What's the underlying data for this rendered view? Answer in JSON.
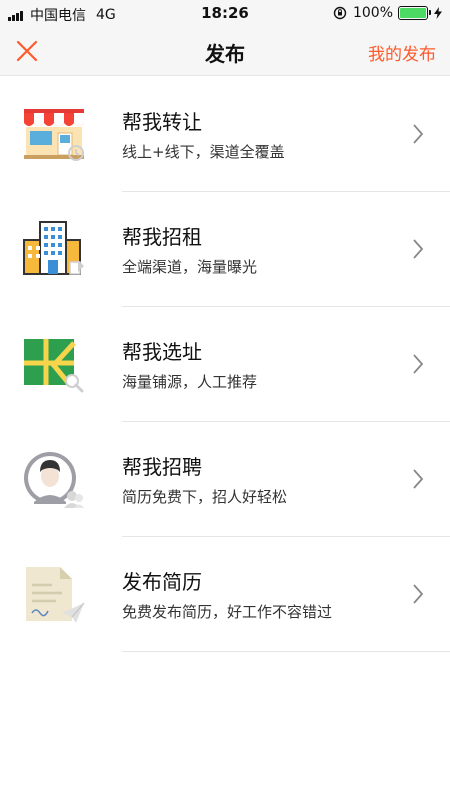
{
  "status_bar": {
    "carrier": "中国电信",
    "network": "4G",
    "time": "18:26",
    "battery": "100%"
  },
  "nav": {
    "title": "发布",
    "right_action": "我的发布",
    "accent_color": "#ff5a2b"
  },
  "items": [
    {
      "title": "帮我转让",
      "subtitle": "线上+线下，渠道全覆盖",
      "icon": "storefront-icon"
    },
    {
      "title": "帮我招租",
      "subtitle": "全端渠道，海量曝光",
      "icon": "building-icon"
    },
    {
      "title": "帮我选址",
      "subtitle": "海量铺源，人工推荐",
      "icon": "map-search-icon"
    },
    {
      "title": "帮我招聘",
      "subtitle": "简历免费下，招人好轻松",
      "icon": "person-avatar-icon"
    },
    {
      "title": "发布简历",
      "subtitle": "免费发布简历，好工作不容错过",
      "icon": "resume-send-icon"
    }
  ]
}
